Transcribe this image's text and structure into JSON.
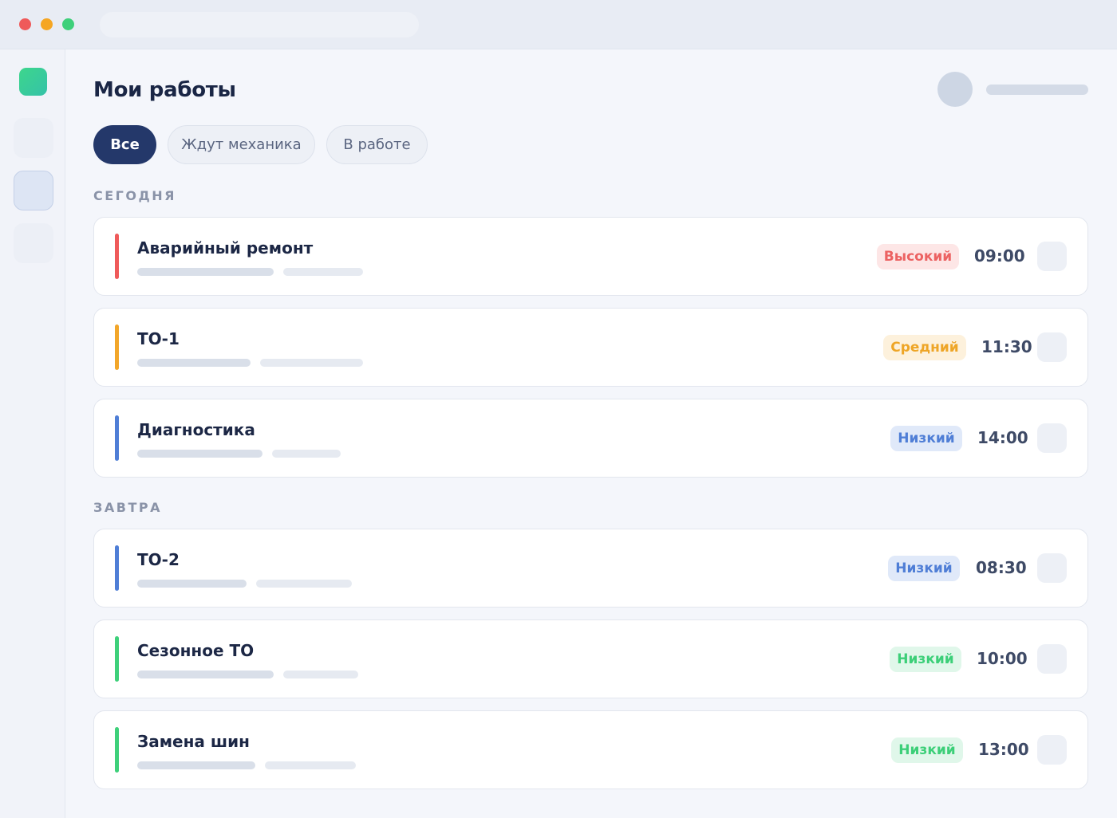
{
  "page": {
    "title": "Мои работы"
  },
  "filters": [
    {
      "label": "Все",
      "active": true
    },
    {
      "label": "Ждут механика",
      "active": false
    },
    {
      "label": "В работе",
      "active": false
    }
  ],
  "colors": {
    "high": "#ef5a5a",
    "medium": "#f2a62a",
    "low_blue": "#4f7ed6",
    "low_green": "#3ed07a",
    "primary": "#24386a"
  },
  "sections": [
    {
      "label": "СЕГОДНЯ",
      "jobs": [
        {
          "title": "Аварийный ремонт",
          "priority": "Высокий",
          "time": "09:00",
          "accent": "high"
        },
        {
          "title": "ТО-1",
          "priority": "Средний",
          "time": "11:30",
          "accent": "medium"
        },
        {
          "title": "Диагностика",
          "priority": "Низкий",
          "time": "14:00",
          "accent": "low_blue"
        }
      ]
    },
    {
      "label": "ЗАВТРА",
      "jobs": [
        {
          "title": "ТО-2",
          "priority": "Низкий",
          "time": "08:30",
          "accent": "low_blue"
        },
        {
          "title": "Сезонное ТО",
          "priority": "Низкий",
          "time": "10:00",
          "accent": "low_green"
        },
        {
          "title": "Замена шин",
          "priority": "Низкий",
          "time": "13:00",
          "accent": "low_green"
        }
      ]
    }
  ]
}
